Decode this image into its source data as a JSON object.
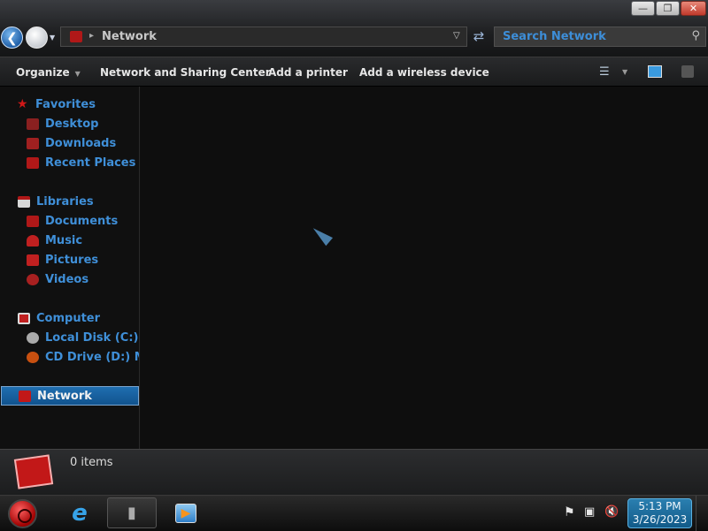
{
  "window": {
    "controls": [
      "minimize",
      "restore",
      "close"
    ]
  },
  "address_bar": {
    "path": "Network"
  },
  "search": {
    "placeholder": "Search Network"
  },
  "toolbar": {
    "organize": "Organize",
    "network_sharing": "Network and Sharing Center",
    "add_printer": "Add a printer",
    "add_wireless": "Add a wireless device"
  },
  "sidebar": {
    "items": [
      {
        "label": "Favorites",
        "icon": "star-icon",
        "color": "#d01818"
      },
      {
        "label": "Desktop",
        "icon": "desktop-icon",
        "color": "#8a2020"
      },
      {
        "label": "Downloads",
        "icon": "downloads-icon",
        "color": "#a02020"
      },
      {
        "label": "Recent Places",
        "icon": "recent-places-icon",
        "color": "#b01818"
      },
      {
        "label": "Libraries",
        "icon": "libraries-icon",
        "color": "#d8d8d8"
      },
      {
        "label": "Documents",
        "icon": "documents-icon",
        "color": "#b01818"
      },
      {
        "label": "Music",
        "icon": "music-icon",
        "color": "#c02020"
      },
      {
        "label": "Pictures",
        "icon": "pictures-icon",
        "color": "#c02020"
      },
      {
        "label": "Videos",
        "icon": "videos-icon",
        "color": "#a82020"
      },
      {
        "label": "Computer",
        "icon": "computer-icon",
        "color": "#c02020"
      },
      {
        "label": "Local Disk (C:)",
        "icon": "disk-icon",
        "color": "#aaaaaa"
      },
      {
        "label": "CD Drive (D:) Mor",
        "icon": "cd-drive-icon",
        "color": "#c85010"
      },
      {
        "label": "Network",
        "icon": "network-icon",
        "color": "#c21818"
      }
    ]
  },
  "details": {
    "items_count": "0 items"
  },
  "taskbar": {
    "clock_time": "5:13 PM",
    "clock_date": "3/26/2023"
  }
}
